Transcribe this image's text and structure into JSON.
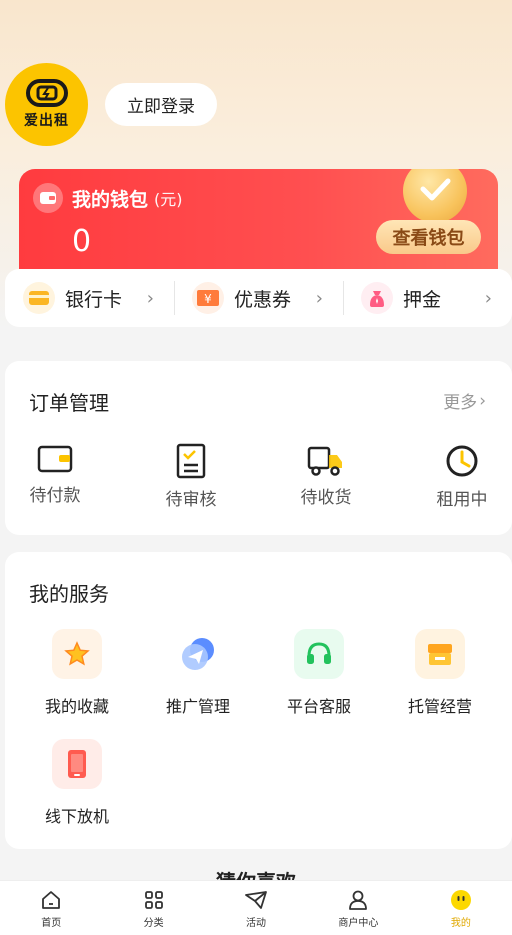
{
  "header": {
    "logo_text": "爱出租",
    "login_button": "立即登录"
  },
  "wallet": {
    "title": "我的钱包",
    "unit": "(元)",
    "balance": "0",
    "view_button": "查看钱包"
  },
  "quick_links": [
    {
      "label": "银行卡",
      "icon": "bank-card-icon"
    },
    {
      "label": "优惠券",
      "icon": "coupon-icon"
    },
    {
      "label": "押金",
      "icon": "deposit-bag-icon"
    }
  ],
  "orders": {
    "title": "订单管理",
    "more": "更多",
    "items": [
      {
        "label": "待付款",
        "icon": "wallet-icon"
      },
      {
        "label": "待审核",
        "icon": "review-clipboard-icon"
      },
      {
        "label": "待收货",
        "icon": "delivery-truck-icon"
      },
      {
        "label": "租用中",
        "icon": "clock-icon"
      }
    ]
  },
  "services": {
    "title": "我的服务",
    "items": [
      {
        "label": "我的收藏",
        "icon": "star-icon"
      },
      {
        "label": "推广管理",
        "icon": "send-icon"
      },
      {
        "label": "平台客服",
        "icon": "headset-icon"
      },
      {
        "label": "托管经营",
        "icon": "store-icon"
      },
      {
        "label": "线下放机",
        "icon": "phone-icon"
      }
    ]
  },
  "recommend_title": "猜你喜欢",
  "tabbar": [
    {
      "label": "首页",
      "icon": "home-icon",
      "active": false
    },
    {
      "label": "分类",
      "icon": "grid-icon",
      "active": false
    },
    {
      "label": "活动",
      "icon": "paper-plane-icon",
      "active": false
    },
    {
      "label": "商户中心",
      "icon": "user-icon",
      "active": false
    },
    {
      "label": "我的",
      "icon": "smiley-icon",
      "active": true
    }
  ],
  "colors": {
    "accent_yellow": "#fcc400",
    "wallet_red": "#ff3b3f",
    "active_tab": "#e0a800"
  }
}
